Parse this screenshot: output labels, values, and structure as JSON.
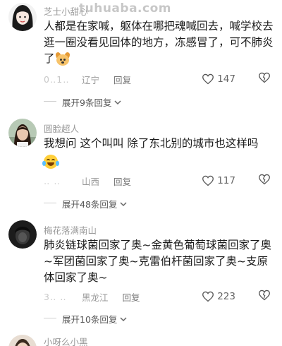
{
  "watermark": "tuhuaba.com",
  "comments": [
    {
      "username": "芝士小甜心",
      "text": "人都是在家喊，躯体在哪把魂喊回去，喊学校去逛一圈没看见回体的地方，冻感冒了，可不肺炎了",
      "emoji": "dog-face-emoji",
      "meta_blur": "0‥1‥",
      "location": "辽宁",
      "reply": "回复",
      "likes": "147",
      "expand": "展开9条回复"
    },
    {
      "username": "圆脸超人",
      "text": "我想问 这个叫叫 除了东北别的城市也这样吗",
      "emoji": "laughing-tears-emoji",
      "meta_blur": "‥  ‥",
      "location": "山西",
      "reply": "回复",
      "likes": "117",
      "expand": "展开48条回复"
    },
    {
      "username": "梅花落满南山",
      "text": "肺炎链球菌回家了奥~金黄色葡萄球菌回家了奥~军团菌回家了奥~克雷伯杆菌回家了奥~支原体回家了奥~",
      "meta_blur": "3‥  ‥",
      "location": "黑龙江",
      "reply": "回复",
      "likes": "223",
      "expand": "展开10条回复"
    },
    {
      "username": "小呀么小黑"
    }
  ]
}
